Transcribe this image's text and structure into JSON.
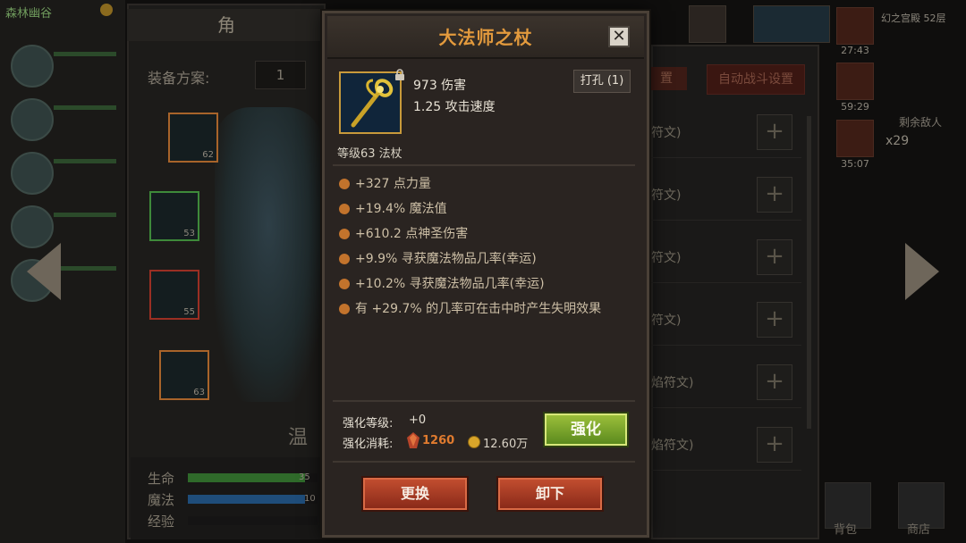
{
  "background": {
    "top_tag": "森林幽谷",
    "character_title": "角",
    "plan_label": "装备方案:",
    "plan_value": "1",
    "hero_name": "温",
    "equip_slots": [
      {
        "level": "62"
      },
      {
        "level": "53"
      },
      {
        "level": "55"
      },
      {
        "level": "63"
      }
    ],
    "stats": [
      {
        "label": "生命",
        "value": "35",
        "fill": 0.9,
        "color": "#2f6a2a"
      },
      {
        "label": "魔法",
        "value": "10",
        "fill": 0.9,
        "color": "#1f4d7a"
      },
      {
        "label": "经验",
        "value": "",
        "fill": 0.0,
        "color": "#5a5a5a"
      }
    ],
    "right_button_partial": "置",
    "auto_battle_button": "自动战斗设置",
    "rune_rows": [
      {
        "text": "符文)"
      },
      {
        "text": "符文)"
      },
      {
        "text": "符文)"
      },
      {
        "text": "符文)"
      },
      {
        "text": "焰符文)"
      },
      {
        "text": "焰符文)"
      }
    ],
    "floor_text": "幻之宫殿 52层",
    "buff_times": [
      "27:43",
      "59:29",
      "35:07"
    ],
    "enemy_label": "剩余敌人",
    "enemy_count": "x29",
    "bag_label": "背包",
    "shop_label": "商店"
  },
  "dialog": {
    "title": "大法师之杖",
    "close_symbol": "✕",
    "damage": "973 伤害",
    "attack_speed": "1.25 攻击速度",
    "socket_button": "打孔 (1)",
    "level_type": "等级63  法杖",
    "affixes": [
      "+327 点力量",
      "+19.4% 魔法值",
      "+610.2 点神圣伤害",
      "+9.9% 寻获魔法物品几率(幸运)",
      "+10.2% 寻获魔法物品几率(幸运)",
      "有 +29.7% 的几率可在击中时产生失明效果"
    ],
    "enhance_level_label": "强化等级:",
    "enhance_level_value": "+0",
    "enhance_cost_label": "强化消耗:",
    "cost_gem": "1260",
    "cost_gold": "12.60万",
    "enhance_button": "强化",
    "replace_button": "更换",
    "unequip_button": "卸下",
    "colors": {
      "title": "#e39a3d",
      "affix_bullet": "#c2732c",
      "enhance_button": "#7ca72c",
      "action_button": "#b0402a",
      "gem_cost": "#e07b2f"
    }
  }
}
